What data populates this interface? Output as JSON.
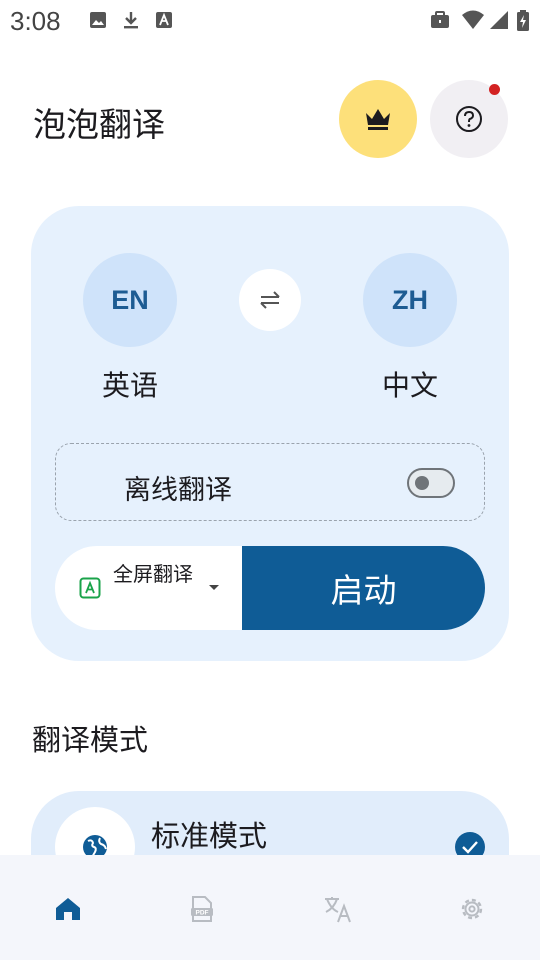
{
  "status_bar": {
    "time": "3:08",
    "left_icons": [
      "image-icon",
      "download-icon",
      "app-a-icon"
    ],
    "right_icons": [
      "briefcase-icon",
      "wifi-icon",
      "signal-icon",
      "battery-charging-icon"
    ]
  },
  "header": {
    "title": "泡泡翻译",
    "premium_icon": "crown-icon",
    "help_icon": "help-icon",
    "colors": {
      "premium_bg": "#fde07a",
      "help_bg": "#f1eff3",
      "notification_dot": "#d32222"
    }
  },
  "languages": {
    "source": {
      "code": "EN",
      "name": "英语"
    },
    "target": {
      "code": "ZH",
      "name": "中文"
    },
    "swap_icon": "swap-icon"
  },
  "offline": {
    "label": "离线翻译",
    "enabled": false,
    "icon": "airplane-icon"
  },
  "action": {
    "mode_select": "全屏翻译",
    "mode_icon": "translate-a-icon",
    "start_label": "启动",
    "colors": {
      "primary": "#0f5c96",
      "card_bg": "#e6f1fd"
    }
  },
  "translation_modes": {
    "title": "翻译模式",
    "items": [
      {
        "name": "标准模式",
        "icon": "globe-icon",
        "selected": true
      }
    ]
  },
  "bottom_nav": {
    "items": [
      {
        "icon": "home-icon",
        "active": true
      },
      {
        "icon": "pdf-icon",
        "active": false
      },
      {
        "icon": "translate-icon",
        "active": false
      },
      {
        "icon": "settings-icon",
        "active": false
      }
    ]
  }
}
